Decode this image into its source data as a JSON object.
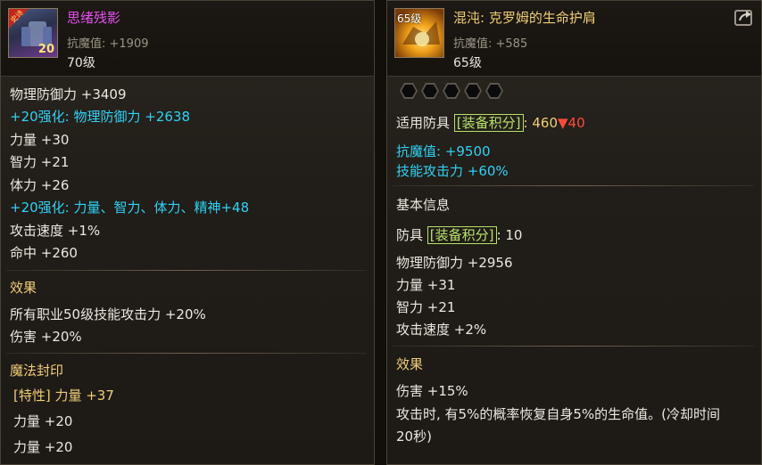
{
  "left": {
    "name": "思绪残影",
    "name_color": "#e44ff0",
    "magic_resist": "抗魔值: +1909",
    "level": "70级",
    "icon_badge": "20",
    "icon_corner": "史诗",
    "lines": [
      {
        "text": "物理防御力 +3409",
        "style": "normal"
      },
      {
        "text": "+20强化: 物理防御力 +2638",
        "style": "cyan"
      },
      {
        "text": "力量 +30",
        "style": "normal"
      },
      {
        "text": "智力 +21",
        "style": "normal"
      },
      {
        "text": "体力 +26",
        "style": "normal"
      },
      {
        "text": "+20强化: 力量、智力、体力、精神+48",
        "style": "cyan"
      },
      {
        "text": "攻击速度 +1%",
        "style": "normal"
      },
      {
        "text": "命中 +260",
        "style": "normal"
      }
    ],
    "effect_title": "效果",
    "effect_lines": [
      "所有职业50级技能攻击力 +20%",
      "伤害 +20%"
    ],
    "seal_title": "魔法封印",
    "seal_lines": [
      "[特性] 力量 +37",
      "力量 +20",
      "力量 +20"
    ]
  },
  "right": {
    "icon_level": "65级",
    "name": "混沌: 克罗姆的生命护肩",
    "name_color": "#f0ce76",
    "magic_resist": "抗魔值: +585",
    "level": "65级",
    "sockets": 5,
    "armor_type_prefix": "适用防具",
    "score_tag": "[装备积分]",
    "score_sep": ":",
    "score_value": "460",
    "score_delta": "▼40",
    "bonus_lines": [
      "抗魔值: +9500",
      "技能攻击力 +60%"
    ],
    "basic_title": "基本信息",
    "armor_prefix": "防具",
    "basic_score_tag": "[装备积分]",
    "basic_score_value": ": 10",
    "basic_lines": [
      "物理防御力 +2956",
      "力量 +31",
      "智力 +21",
      "攻击速度 +2%"
    ],
    "effect_title": "效果",
    "effect_lines": [
      "伤害 +15%",
      "攻击时, 有5%的概率恢复自身5%的生命值。(冷却时间",
      "20秒)"
    ]
  },
  "icons": {
    "share": "share-arrow-icon"
  }
}
